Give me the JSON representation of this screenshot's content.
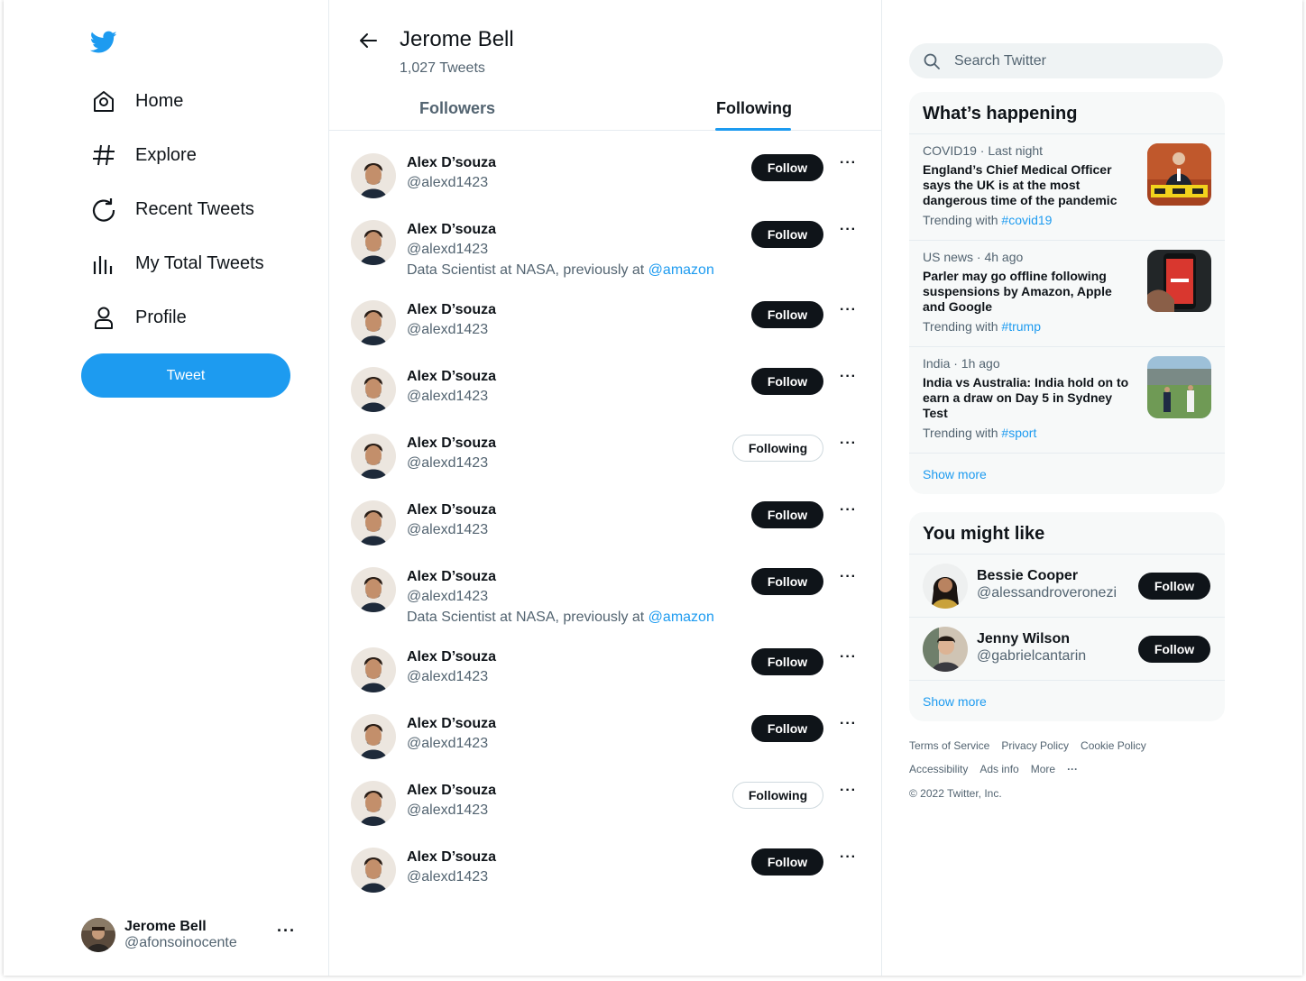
{
  "sidebar": {
    "items": [
      {
        "label": "Home",
        "icon": "home-icon"
      },
      {
        "label": "Explore",
        "icon": "hashtag-icon"
      },
      {
        "label": "Recent Tweets",
        "icon": "refresh-icon"
      },
      {
        "label": "My Total Tweets",
        "icon": "bar-chart-icon"
      },
      {
        "label": "Profile",
        "icon": "user-icon"
      }
    ],
    "tweet_label": "Tweet",
    "account": {
      "name": "Jerome Bell",
      "handle": "@afonsoinocente",
      "more": "···"
    }
  },
  "header": {
    "title": "Jerome Bell",
    "subtitle": "1,027 Tweets"
  },
  "tabs": {
    "followers": "Followers",
    "following": "Following",
    "active": "following"
  },
  "list": [
    {
      "name": "Alex D’souza",
      "handle": "@alexd1423",
      "bio": "",
      "bio_link": "",
      "button": "Follow",
      "state": "follow"
    },
    {
      "name": "Alex D’souza",
      "handle": "@alexd1423",
      "bio": "Data Scientist at NASA, previously at ",
      "bio_link": "@amazon",
      "button": "Follow",
      "state": "follow"
    },
    {
      "name": "Alex D’souza",
      "handle": "@alexd1423",
      "bio": "",
      "bio_link": "",
      "button": "Follow",
      "state": "follow"
    },
    {
      "name": "Alex D’souza",
      "handle": "@alexd1423",
      "bio": "",
      "bio_link": "",
      "button": "Follow",
      "state": "follow"
    },
    {
      "name": "Alex D’souza",
      "handle": "@alexd1423",
      "bio": "",
      "bio_link": "",
      "button": "Following",
      "state": "following"
    },
    {
      "name": "Alex D’souza",
      "handle": "@alexd1423",
      "bio": "",
      "bio_link": "",
      "button": "Follow",
      "state": "follow"
    },
    {
      "name": "Alex D’souza",
      "handle": "@alexd1423",
      "bio": "Data Scientist at NASA, previously at ",
      "bio_link": "@amazon",
      "button": "Follow",
      "state": "follow"
    },
    {
      "name": "Alex D’souza",
      "handle": "@alexd1423",
      "bio": "",
      "bio_link": "",
      "button": "Follow",
      "state": "follow"
    },
    {
      "name": "Alex D’souza",
      "handle": "@alexd1423",
      "bio": "",
      "bio_link": "",
      "button": "Follow",
      "state": "follow"
    },
    {
      "name": "Alex D’souza",
      "handle": "@alexd1423",
      "bio": "",
      "bio_link": "",
      "button": "Following",
      "state": "following"
    },
    {
      "name": "Alex D’souza",
      "handle": "@alexd1423",
      "bio": "",
      "bio_link": "",
      "button": "Follow",
      "state": "follow"
    }
  ],
  "list_more": "···",
  "search": {
    "placeholder": "Search Twitter"
  },
  "happening": {
    "title": "What’s happening",
    "trends": [
      {
        "meta": "COVID19 · Last night",
        "headline": "England’s Chief Medical Officer says the UK is at the most dangerous time of the pandemic",
        "trending_prefix": "Trending with ",
        "tag": "#covid19"
      },
      {
        "meta": "US news · 4h ago",
        "headline": "Parler may go offline following suspensions by Amazon, Apple and Google",
        "trending_prefix": "Trending with ",
        "tag": "#trump"
      },
      {
        "meta": "India · 1h ago",
        "headline": "India vs Australia: India hold on to earn a draw on Day 5 in Sydney Test",
        "trending_prefix": "Trending with ",
        "tag": "#sport"
      }
    ],
    "show_more": "Show more"
  },
  "might_like": {
    "title": "You might like",
    "users": [
      {
        "name": "Bessie Cooper",
        "handle": "@alessandroveronezi",
        "button": "Follow"
      },
      {
        "name": "Jenny Wilson",
        "handle": "@gabrielcantarin",
        "button": "Follow"
      }
    ],
    "show_more": "Show more"
  },
  "footer": {
    "links": [
      "Terms of Service",
      "Privacy Policy",
      "Cookie Policy",
      "Accessibility",
      "Ads info",
      "More",
      "···"
    ],
    "copyright": "© 2022 Twitter, Inc."
  },
  "colors": {
    "accent": "#1d9bf0",
    "text": "#0f1419",
    "muted": "#536471",
    "panel": "#f7f9f9"
  }
}
